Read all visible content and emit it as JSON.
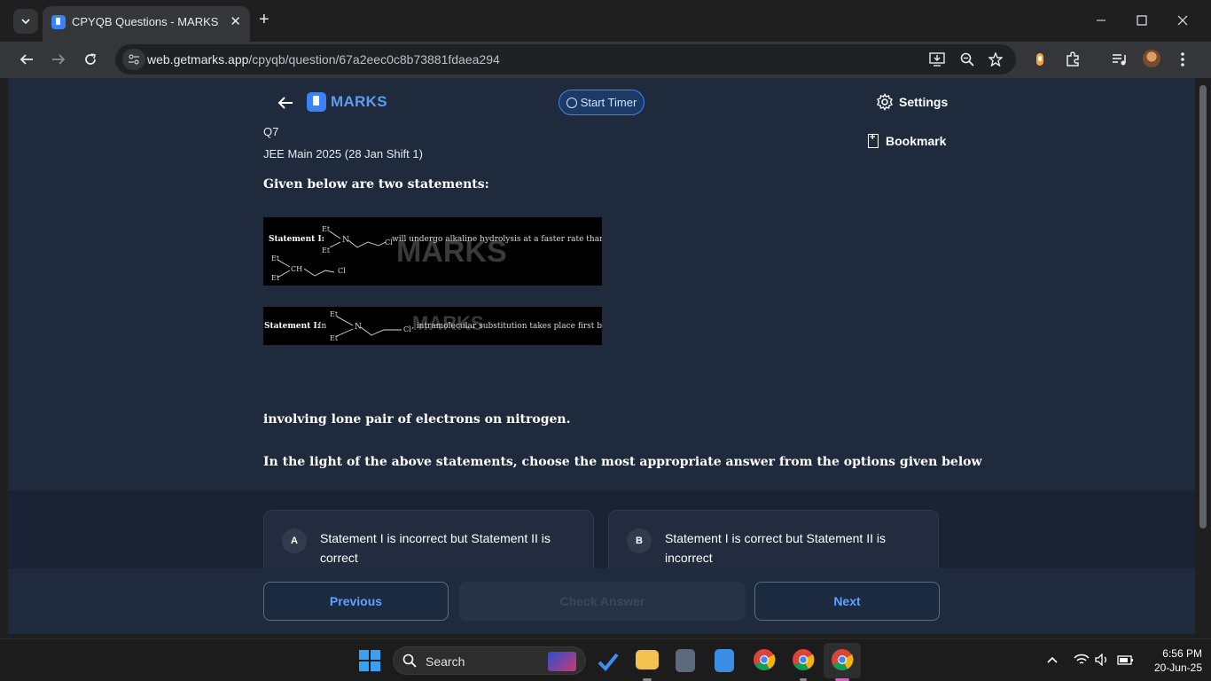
{
  "browser": {
    "tab_title": "CPYQB Questions - MARKS App",
    "tab_close": "✕",
    "new_tab": "+",
    "url_host": "web.getmarks.app",
    "url_path": "/cpyqb/question/67a2eec0c8b73881fdaea294"
  },
  "header": {
    "logo_text": "MARKS",
    "timer_label": "Start Timer",
    "settings_label": "Settings"
  },
  "question": {
    "number": "Q7",
    "source": "JEE Main 2025 (28 Jan Shift 1)",
    "bookmark_label": "Bookmark",
    "intro": "Given below are two statements:",
    "statement1": {
      "label": "Statement I:",
      "text": "will undergo alkaline hydrolysis at a faster rate than",
      "chem_a": "Et",
      "chem_b": "N",
      "chem_c": "Cl",
      "chem_d": "CH",
      "watermark": "MARKS"
    },
    "statement2": {
      "label": "Statement II:",
      "label_suffix": "In",
      "text": ", intramolecular substitution takes place first by",
      "watermark": "MARKS"
    },
    "continuation": "involving lone pair of electrons on nitrogen.",
    "ask": "In the light of the above statements, choose the most appropriate answer from the options given below"
  },
  "options": [
    {
      "letter": "A",
      "text": "Statement I is incorrect but Statement II is correct"
    },
    {
      "letter": "B",
      "text": "Statement I is correct but Statement II is incorrect"
    }
  ],
  "footer": {
    "previous": "Previous",
    "check": "Check Answer",
    "next": "Next"
  },
  "taskbar": {
    "search_label": "Search",
    "time": "6:56 PM",
    "date": "20-Jun-25"
  },
  "colors": {
    "page_bg": "#1f2b3d",
    "accent": "#3b82f6",
    "button_text": "#5ea2ff"
  }
}
